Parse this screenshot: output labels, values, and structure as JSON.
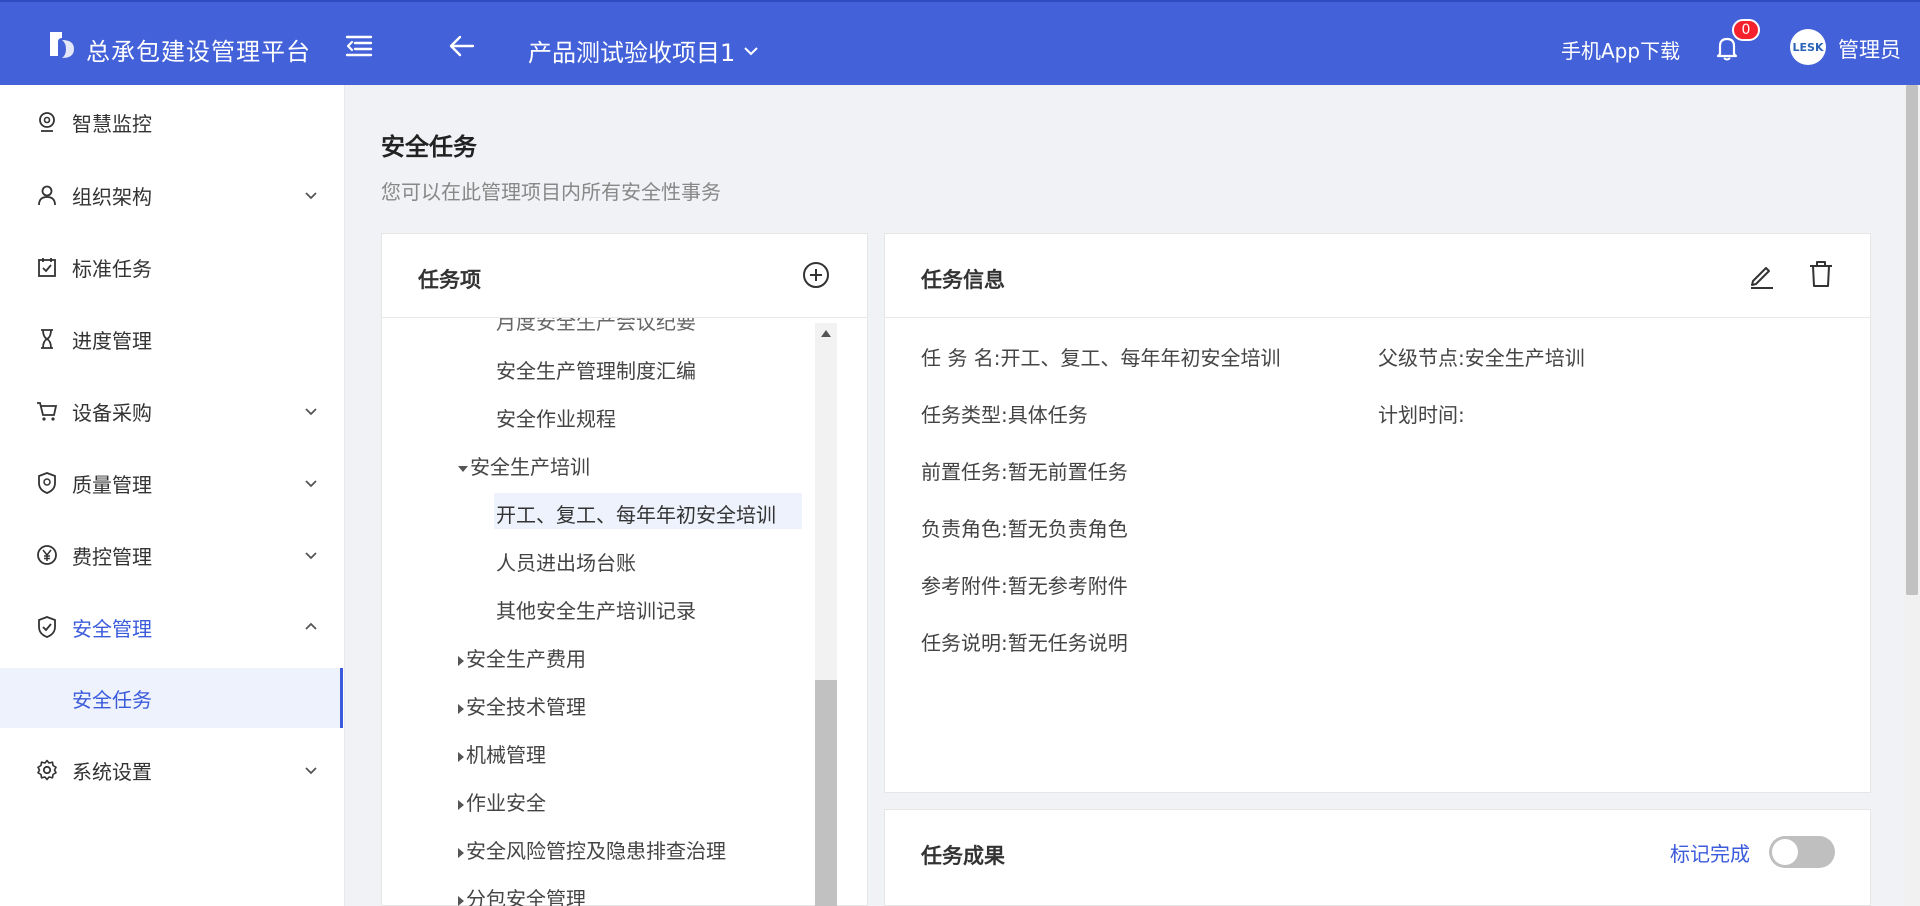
{
  "header": {
    "app_title": "总承包建设管理平台",
    "project_name": "产品测试验收项目1",
    "app_download": "手机App下载",
    "notification_count": "0",
    "avatar_text": "LESK",
    "user_name": "管理员",
    "colors": {
      "bar": "#4361d8",
      "badge": "#f5222d"
    }
  },
  "sidebar": {
    "items": [
      {
        "label": "智慧监控",
        "icon": "monitor-icon"
      },
      {
        "label": "组织架构",
        "icon": "user-icon",
        "expandable": true
      },
      {
        "label": "标准任务",
        "icon": "calendar-check-icon"
      },
      {
        "label": "进度管理",
        "icon": "hourglass-icon"
      },
      {
        "label": "设备采购",
        "icon": "cart-icon",
        "expandable": true
      },
      {
        "label": "质量管理",
        "icon": "shield-badge-icon",
        "expandable": true
      },
      {
        "label": "费控管理",
        "icon": "yen-icon",
        "expandable": true
      },
      {
        "label": "安全管理",
        "icon": "shield-check-icon",
        "expandable": true,
        "expanded": true,
        "active": true
      },
      {
        "label": "系统设置",
        "icon": "gear-icon",
        "expandable": true
      }
    ],
    "sub_item": {
      "label": "安全任务"
    },
    "accent": "#3b5bdb"
  },
  "page": {
    "title": "安全任务",
    "description": "您可以在此管理项目内所有安全性事务"
  },
  "task_tree": {
    "title": "任务项",
    "partial_top": "月度安全生产会议纪要",
    "items": [
      {
        "label": "安全生产管理制度汇编",
        "level": 2
      },
      {
        "label": "安全作业规程",
        "level": 2
      },
      {
        "label": "安全生产培训",
        "level": 1,
        "caret": "down"
      },
      {
        "label": "开工、复工、每年年初安全培训",
        "level": 2,
        "selected": true
      },
      {
        "label": "人员进出场台账",
        "level": 2
      },
      {
        "label": "其他安全生产培训记录",
        "level": 2
      },
      {
        "label": "安全生产费用",
        "level": 1,
        "caret": "right"
      },
      {
        "label": "安全技术管理",
        "level": 1,
        "caret": "right"
      },
      {
        "label": "机械管理",
        "level": 1,
        "caret": "right"
      },
      {
        "label": "作业安全",
        "level": 1,
        "caret": "right"
      },
      {
        "label": "安全风险管控及隐患排查治理",
        "level": 1,
        "caret": "right"
      },
      {
        "label": "分包安全管理",
        "level": 1,
        "caret": "right"
      }
    ]
  },
  "task_info": {
    "title": "任务信息",
    "name_key": "任 务 名:",
    "name_val": "开工、复工、每年年初安全培训",
    "parent_key": "父级节点:",
    "parent_val": "安全生产培训",
    "type_key": "任务类型:",
    "type_val": "具体任务",
    "plan_key": "计划时间:",
    "plan_val": "",
    "pre_key": "前置任务:",
    "pre_val": "暂无前置任务",
    "role_key": "负责角色:",
    "role_val": "暂无负责角色",
    "attach_key": "参考附件:",
    "attach_val": "暂无参考附件",
    "desc_key": "任务说明:",
    "desc_val": "暂无任务说明"
  },
  "task_result": {
    "title": "任务成果",
    "mark_label": "标记完成",
    "mark_done": false
  }
}
